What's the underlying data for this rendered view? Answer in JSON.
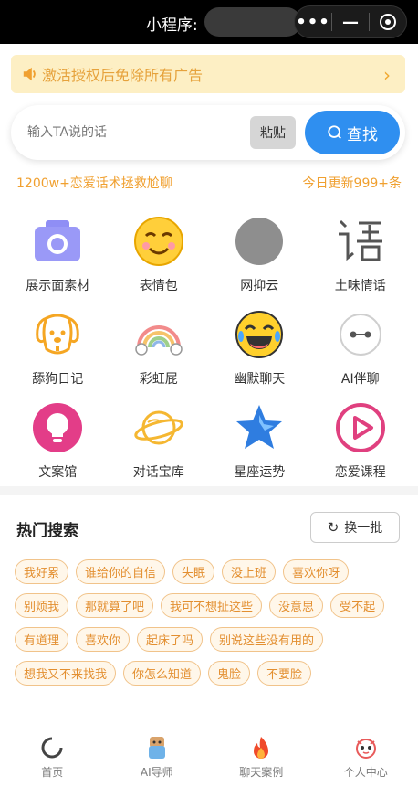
{
  "topbar": {
    "title": "小程序:",
    "more_icon": "more-dots-icon",
    "minimize_icon": "minimize-icon",
    "close_icon": "target-icon"
  },
  "notice": {
    "text": "激活授权后免除所有广告",
    "icon": "speaker-icon",
    "arrow": "›",
    "color": "#e6a23c",
    "bg": "#fdefc4"
  },
  "search": {
    "placeholder": "输入TA说的话",
    "value": "",
    "paste_label": "粘贴",
    "find_label": "查找",
    "accent": "#2f8ff0"
  },
  "stats": {
    "left": "1200w+恋爱话术拯救尬聊",
    "right": "今日更新999+条"
  },
  "features": [
    {
      "label": "展示面素材",
      "icon": "camera-icon"
    },
    {
      "label": "表情包",
      "icon": "emoji-face-icon"
    },
    {
      "label": "网抑云",
      "icon": "gray-circle-icon"
    },
    {
      "label": "土味情话",
      "icon": "speech-character-icon"
    },
    {
      "label": "舔狗日记",
      "icon": "dog-icon"
    },
    {
      "label": "彩虹屁",
      "icon": "rainbow-icon"
    },
    {
      "label": "幽默聊天",
      "icon": "laughing-face-icon"
    },
    {
      "label": "AI伴聊",
      "icon": "ai-robot-icon"
    },
    {
      "label": "文案馆",
      "icon": "lightbulb-icon"
    },
    {
      "label": "对话宝库",
      "icon": "planet-icon"
    },
    {
      "label": "星座运势",
      "icon": "star-icon"
    },
    {
      "label": "恋爱课程",
      "icon": "play-circle-icon"
    }
  ],
  "hot": {
    "title": "热门搜索",
    "refresh_label": "换一批",
    "tags": [
      "我好累",
      "谁给你的自信",
      "失眠",
      "没上班",
      "喜欢你呀",
      "别烦我",
      "那就算了吧",
      "我可不想扯这些",
      "没意思",
      "受不起",
      "有道理",
      "喜欢你",
      "起床了吗",
      "别说这些没有用的",
      "想我又不来找我",
      "你怎么知道",
      "鬼脸",
      "不要脸"
    ]
  },
  "tabbar": [
    {
      "label": "首页",
      "icon": "home-ring-icon"
    },
    {
      "label": "AI导师",
      "icon": "ai-mentor-icon"
    },
    {
      "label": "聊天案例",
      "icon": "flame-icon"
    },
    {
      "label": "个人中心",
      "icon": "profile-icon"
    }
  ]
}
